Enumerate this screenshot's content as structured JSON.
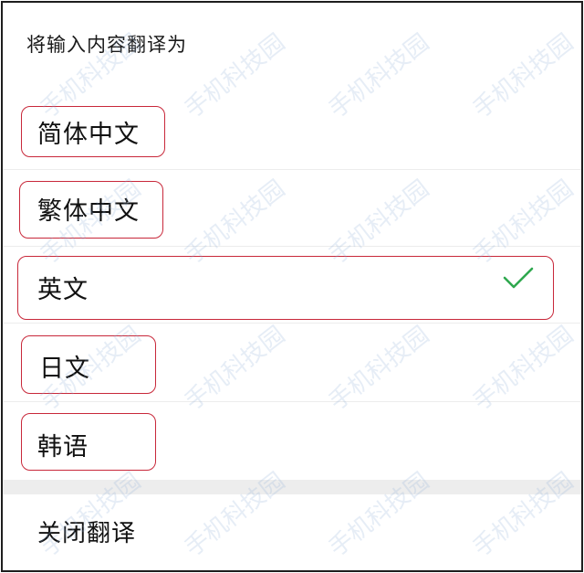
{
  "dialog": {
    "title": "将输入内容翻译为",
    "options": [
      {
        "label": "简体中文",
        "selected": false
      },
      {
        "label": "繁体中文",
        "selected": false
      },
      {
        "label": "英文",
        "selected": true
      },
      {
        "label": "日文",
        "selected": false
      },
      {
        "label": "韩语",
        "selected": false
      }
    ],
    "close_label": "关闭翻译"
  },
  "watermark": {
    "text": "手机科技园"
  },
  "colors": {
    "check": "#2fa84f",
    "annotation": "#c8283a",
    "divider_band": "#ededed"
  }
}
